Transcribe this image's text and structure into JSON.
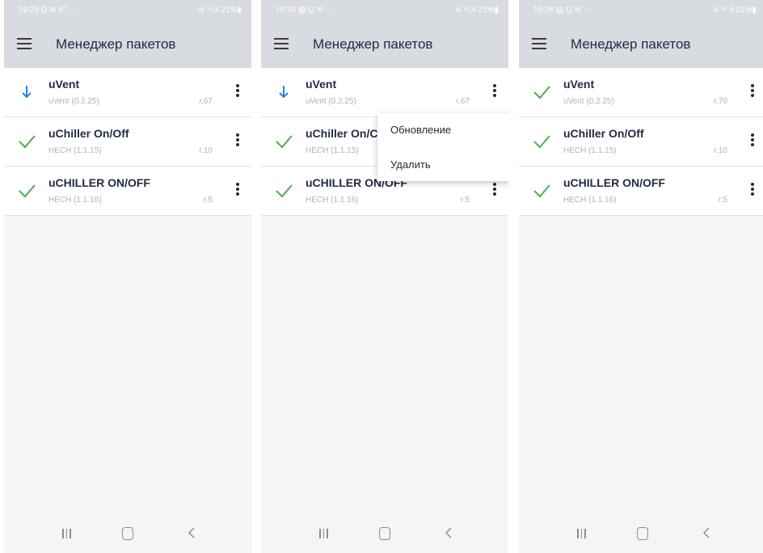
{
  "colors": {
    "appbar_bg": "#d8dbe0",
    "accent_blue": "#1e88e5",
    "check_green": "#4caf50",
    "title_text": "#1f2a44",
    "muted_text": "#b0b3bb"
  },
  "icons": {
    "menu": "hamburger-menu-icon",
    "download": "download-arrow-icon",
    "installed": "checkmark-icon",
    "more": "more-vertical-icon",
    "nav_recents": "recents-icon",
    "nav_home": "home-icon",
    "nav_back": "back-icon"
  },
  "screens": [
    {
      "status": {
        "time": "19:25 Q ✉ 8° ···",
        "right": "≋ ᵛᵒ.ıl 21%▮"
      },
      "title": "Менеджер пакетов",
      "packages": [
        {
          "name": "uVent",
          "sub": "uVent (0.2.25)",
          "rev": "r.67",
          "state": "download"
        },
        {
          "name": "uChiller On/Off",
          "sub": "HECH (1.1.15)",
          "rev": "r.10",
          "state": "installed"
        },
        {
          "name": "uCHILLER ON/OFF",
          "sub": "HECH (1.1.16)",
          "rev": "r.5",
          "state": "installed"
        }
      ]
    },
    {
      "status": {
        "time": "19:25 ▨ Q ✉ ···",
        "right": "≋ ᵛᵒ.ıl 21%▮"
      },
      "title": "Менеджер пакетов",
      "packages": [
        {
          "name": "uVent",
          "sub": "uVent (0.2.25)",
          "rev": "r.67",
          "state": "download"
        },
        {
          "name": "uChiller On/C",
          "sub": "HECH (1.1.15)",
          "rev": "",
          "state": "installed"
        },
        {
          "name": "uCHILLER ON/OFF",
          "sub": "HECH (1.1.16)",
          "rev": "r.5",
          "state": "installed"
        }
      ],
      "context_menu": [
        "Обновление",
        "Удалить"
      ]
    },
    {
      "status": {
        "time": "19:26 ▨ Q ✉ ···",
        "right": "≋ ᵛᵒ.ıl 21%▮"
      },
      "title": "Менеджер пакетов",
      "packages": [
        {
          "name": "uVent",
          "sub": "uVent (0.2.25)",
          "rev": "r.70",
          "state": "installed"
        },
        {
          "name": "uChiller On/Off",
          "sub": "HECH (1.1.15)",
          "rev": "r.10",
          "state": "installed"
        },
        {
          "name": "uCHILLER ON/OFF",
          "sub": "HECH (1.1.16)",
          "rev": "r.5",
          "state": "installed"
        }
      ]
    }
  ]
}
